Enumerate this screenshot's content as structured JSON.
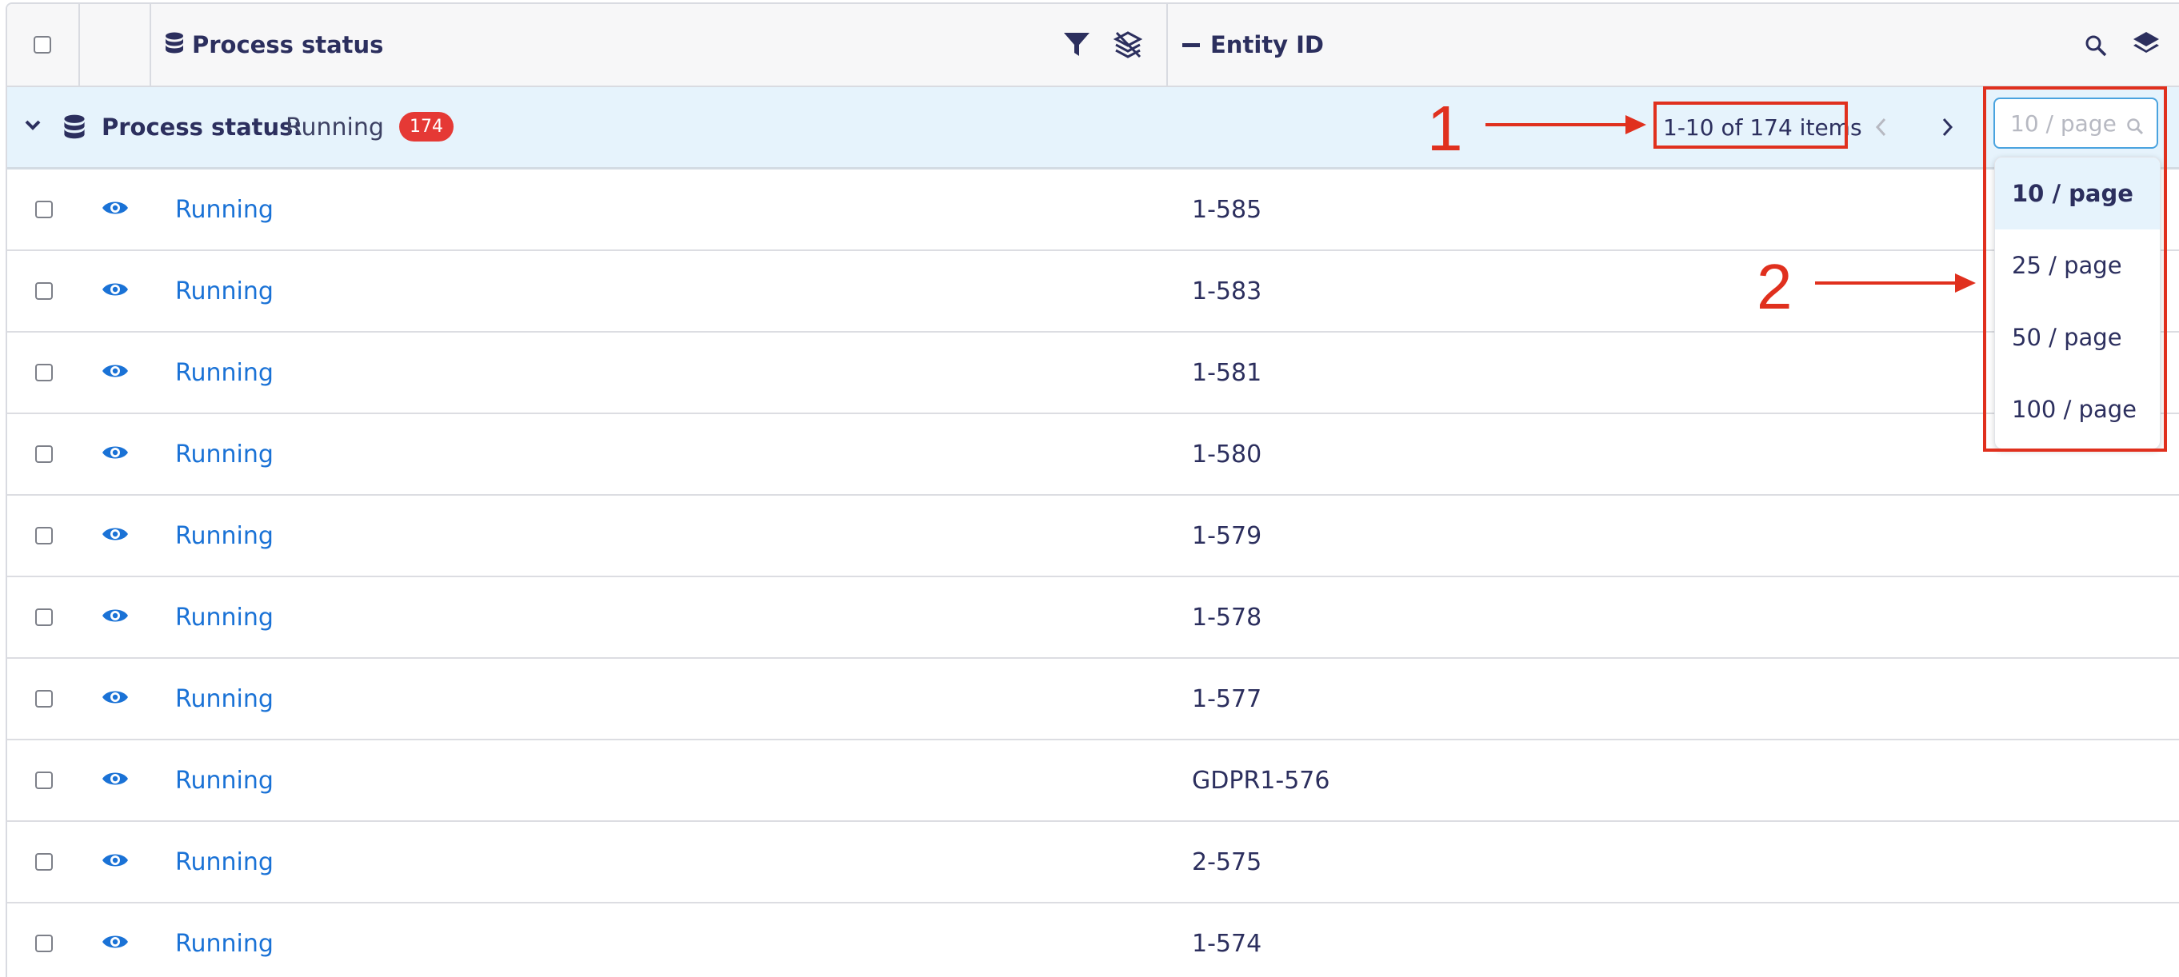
{
  "header": {
    "process_status_label": "Process status",
    "entity_id_label": "Entity ID"
  },
  "group": {
    "label": "Process status:",
    "value": "Running",
    "count": "174",
    "range_text": "1-10 of 174 items",
    "page_size_placeholder": "10 / page"
  },
  "page_size_options": [
    "10 / page",
    "25 / page",
    "50 / page",
    "100 / page"
  ],
  "selected_page_size": "10 / page",
  "rows": [
    {
      "status": "Running",
      "entity_id": "1-585"
    },
    {
      "status": "Running",
      "entity_id": "1-583"
    },
    {
      "status": "Running",
      "entity_id": "1-581"
    },
    {
      "status": "Running",
      "entity_id": "1-580"
    },
    {
      "status": "Running",
      "entity_id": "1-579"
    },
    {
      "status": "Running",
      "entity_id": "1-578"
    },
    {
      "status": "Running",
      "entity_id": "1-577"
    },
    {
      "status": "Running",
      "entity_id": "GDPR1-576"
    },
    {
      "status": "Running",
      "entity_id": "2-575"
    },
    {
      "status": "Running",
      "entity_id": "1-574"
    }
  ],
  "annotations": {
    "one": "1",
    "two": "2"
  },
  "icons": {
    "header": [
      "database-icon",
      "filter-icon",
      "layers-off-icon",
      "minus-icon",
      "search-icon",
      "layers-icon"
    ],
    "row": [
      "eye-icon"
    ],
    "group": [
      "chevron-down-icon",
      "database-icon",
      "chevron-left-icon",
      "chevron-right-icon",
      "search-icon"
    ]
  },
  "colors": {
    "link": "#1a72d6",
    "group_background": "#e6f3fc",
    "badge": "#e53935",
    "annotation": "#e0301e",
    "text": "#2c2f5e"
  }
}
